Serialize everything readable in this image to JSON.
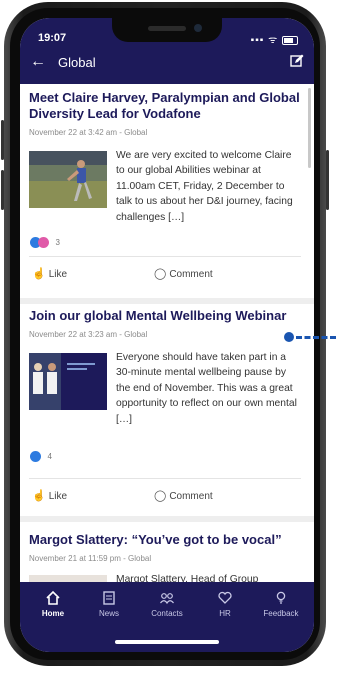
{
  "status_bar": {
    "time": "19:07",
    "signal": "▪▪▪ ᯤ"
  },
  "header": {
    "title": "Global"
  },
  "posts": [
    {
      "title": "Meet Claire Harvey, Paralympian and Global Diversity Lead for Vodafone",
      "meta": "November 22 at 3:42 am - Global",
      "body": "We are very excited to welcome Claire to our global Abilities webinar at 11.00am CET, Friday, 2 December to talk to us about her D&I journey, facing challenges […]",
      "reaction_count": "3",
      "like_label": "Like",
      "comment_label": "Comment"
    },
    {
      "title": "Join our global Mental Wellbeing Webinar",
      "meta": "November 22 at 3:23 am - Global",
      "body": "Everyone should have taken part in a 30-minute mental wellbeing pause by the end of November. This was a great opportunity to reflect on our own mental […]",
      "reaction_count": "4",
      "like_label": "Like",
      "comment_label": "Comment"
    },
    {
      "title": "Margot Slattery: “You’ve got to be vocal”",
      "meta": "November 21 at 11:59 pm - Global",
      "body": "Margot Slattery, Head of Group"
    }
  ],
  "tabs": [
    {
      "label": "Home",
      "icon": "home-icon"
    },
    {
      "label": "News",
      "icon": "news-icon"
    },
    {
      "label": "Contacts",
      "icon": "contacts-icon"
    },
    {
      "label": "HR",
      "icon": "heart-icon"
    },
    {
      "label": "Feedback",
      "icon": "lightbulb-icon"
    }
  ],
  "colors": {
    "brand": "#1d1a5a",
    "like_blue": "#2d7be0",
    "love_pink": "#e05aa8",
    "pointer": "#1a55b0"
  }
}
